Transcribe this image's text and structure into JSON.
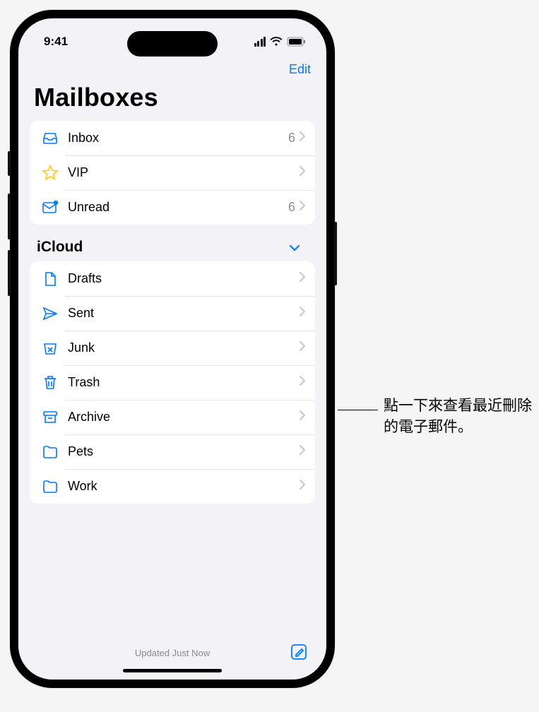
{
  "status": {
    "time": "9:41"
  },
  "nav": {
    "edit": "Edit"
  },
  "title": "Mailboxes",
  "smart_boxes": [
    {
      "icon": "inbox",
      "label": "Inbox",
      "count": "6"
    },
    {
      "icon": "star",
      "label": "VIP",
      "count": ""
    },
    {
      "icon": "unread",
      "label": "Unread",
      "count": "6"
    }
  ],
  "account": {
    "name": "iCloud"
  },
  "folders": [
    {
      "icon": "drafts",
      "label": "Drafts"
    },
    {
      "icon": "sent",
      "label": "Sent"
    },
    {
      "icon": "junk",
      "label": "Junk"
    },
    {
      "icon": "trash",
      "label": "Trash"
    },
    {
      "icon": "archive",
      "label": "Archive"
    },
    {
      "icon": "folder",
      "label": "Pets"
    },
    {
      "icon": "folder",
      "label": "Work"
    }
  ],
  "toolbar": {
    "status": "Updated Just Now"
  },
  "callout": {
    "text": "點一下來查看最近刪除的電子郵件。"
  },
  "colors": {
    "accent": "#007aff"
  }
}
